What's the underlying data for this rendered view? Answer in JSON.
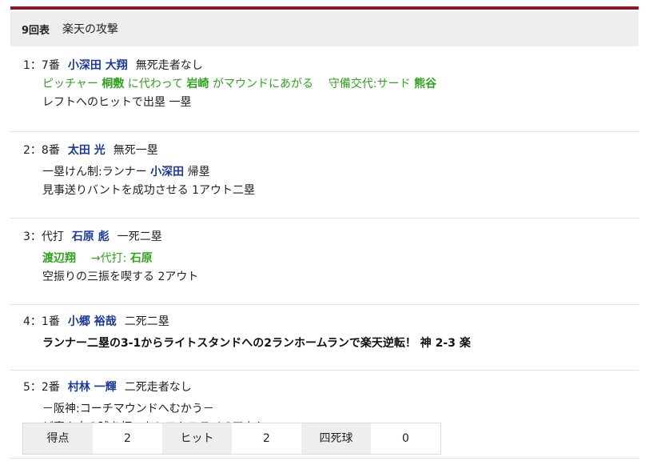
{
  "header": {
    "inning": "9回表",
    "title": "楽天の攻撃"
  },
  "plays": [
    {
      "order": "1：7番",
      "batter": "小深田 大翔",
      "situation": "無死走者なし",
      "sub": {
        "prefix": "ピッチャー",
        "out_name": "桐敷",
        "mid": "に代わって",
        "in_name": "岩崎",
        "suffix": "がマウンドにあがる",
        "def_text": "守備交代:サード",
        "def_name": "熊谷"
      },
      "result": "レフトへのヒットで出塁 一塁"
    },
    {
      "order": "2：8番",
      "batter": "太田 光",
      "situation": "無死一塁",
      "event_prefix": "一塁けん制:ランナー",
      "event_name": "小深田",
      "event_suffix": "帰塁",
      "result": "見事送りバントを成功させる 1アウト二塁"
    },
    {
      "order": "3：代打",
      "batter": "石原 彪",
      "situation": "一死二塁",
      "ph": {
        "out_name": "渡辺翔",
        "arrow_text": "→代打:",
        "in_name": "石原"
      },
      "result": "空振りの三振を喫する 2アウト"
    },
    {
      "order": "4：1番",
      "batter": "小郷 裕哉",
      "situation": "二死二塁",
      "result": "ランナー二塁の3-1からライトスタンドへの2ランホームランで楽天逆転！ 神 2-3 楽"
    },
    {
      "order": "5：2番",
      "batter": "村林 一輝",
      "situation": "二死走者なし",
      "event": "－阪神:コーチマウンドへむかう－",
      "result": "ど真ん中の球を打つもレフトフライ 3アウト"
    }
  ],
  "stats": {
    "runs_label": "得点",
    "runs": "2",
    "hits_label": "ヒット",
    "hits": "2",
    "walks_label": "四死球",
    "walks": "0"
  },
  "colors": {
    "accent_bar": "#8c1a2a",
    "player_name": "#1a3a9c",
    "substitution": "#2fa31c"
  }
}
